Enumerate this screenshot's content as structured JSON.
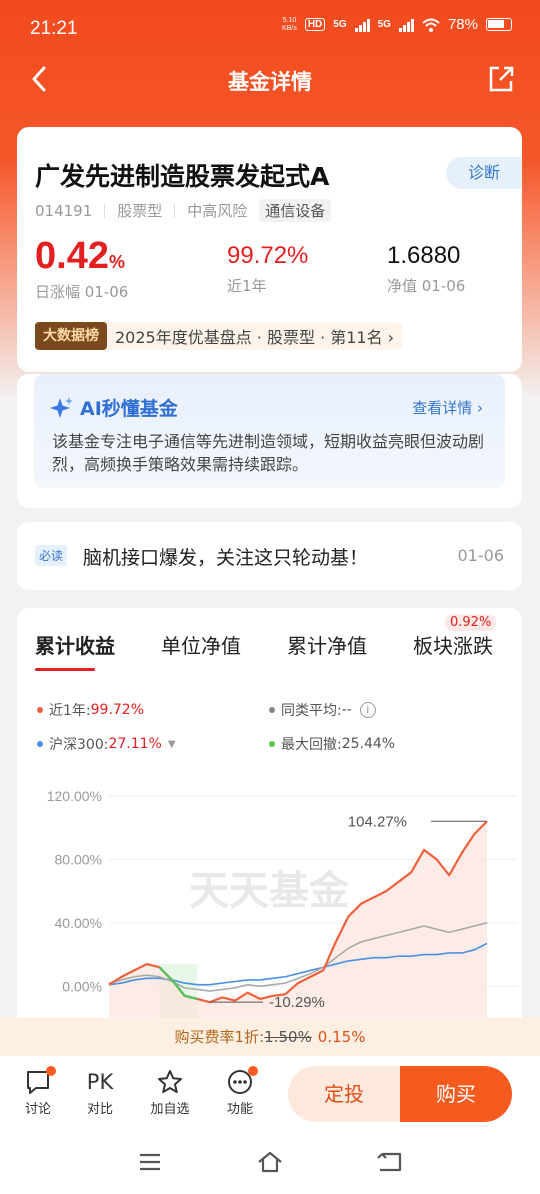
{
  "status": {
    "time": "21:21",
    "net_speed_value": "5.10",
    "net_speed_unit": "KB/s",
    "hd_label": "HD",
    "sig1": "5G",
    "sig2": "5G",
    "battery": "78%"
  },
  "nav": {
    "title": "基金详情"
  },
  "fund": {
    "name": "广发先进制造股票发起式A",
    "code": "014191",
    "type": "股票型",
    "risk": "中高风险",
    "sector": "通信设备",
    "diagnose_label": "诊断",
    "daily_change_value": "0.42",
    "daily_change_unit": "%",
    "daily_change_label": "日涨幅 01-06",
    "year_return": "99.72%",
    "year_return_label": "近1年",
    "nav_value": "1.6880",
    "nav_label": "净值 01-06",
    "rank_badge": "大数据榜",
    "rank_text": "2025年度优基盘点 · 股票型 · 第11名 ›"
  },
  "ai": {
    "title": "AI秒懂基金",
    "more": "查看详情 ›",
    "desc": "该基金专注电子通信等先进制造领域，短期收益亮眼但波动剧烈，高频换手策略效果需持续跟踪。"
  },
  "news": {
    "badge": "必读",
    "text": "脑机接口爆发，关注这只轮动基！",
    "date": "01-06"
  },
  "chart": {
    "tabs": [
      "累计收益",
      "单位净值",
      "累计净值",
      "板块涨跌"
    ],
    "tab_badge": "0.92%",
    "legend": {
      "fund_label": "近1年:",
      "fund_value": "99.72%",
      "peer_label": "同类平均:",
      "peer_value": "--",
      "index_label": "沪深300:",
      "index_value": "27.11%",
      "drawdown_label": "最大回撤:",
      "drawdown_value": "25.44%"
    },
    "watermark": "天天基金",
    "max_label": "104.27%",
    "min_label": "-10.29%",
    "colors": {
      "fund": "#f0603a",
      "index": "#4a90e2",
      "peer": "#aaaaaa",
      "drawdown": "#5cc25c"
    }
  },
  "chart_data": {
    "type": "line",
    "y_ticks": [
      "120.00%",
      "80.00%",
      "40.00%",
      "0.00%"
    ],
    "ylim": [
      -20,
      125
    ],
    "x": [
      0,
      1,
      2,
      3,
      4,
      5,
      6,
      7,
      8,
      9,
      10,
      11,
      12,
      13,
      14,
      15,
      16,
      17,
      18,
      19,
      20,
      21,
      22,
      23,
      24,
      25,
      26,
      27,
      28,
      29,
      30
    ],
    "series": [
      {
        "name": "近1年",
        "values": [
          1,
          6,
          10,
          14,
          12,
          4,
          -6,
          -8,
          -10,
          -7,
          -9,
          -4,
          -8,
          -6,
          -5,
          2,
          6,
          10,
          28,
          44,
          52,
          56,
          60,
          66,
          72,
          86,
          80,
          70,
          84,
          96,
          104
        ]
      },
      {
        "name": "同类平均",
        "values": [
          2,
          4,
          6,
          7,
          6,
          3,
          -1,
          -2,
          -3,
          -2,
          -1,
          1,
          0,
          1,
          2,
          5,
          8,
          12,
          18,
          24,
          28,
          30,
          32,
          34,
          36,
          38,
          36,
          34,
          36,
          38,
          40
        ]
      },
      {
        "name": "沪深300",
        "values": [
          1,
          2,
          4,
          5,
          5,
          4,
          2,
          1,
          1,
          2,
          3,
          4,
          4,
          5,
          6,
          8,
          10,
          12,
          14,
          16,
          17,
          18,
          18,
          19,
          19,
          20,
          20,
          21,
          21,
          23,
          27
        ]
      }
    ]
  },
  "fee": {
    "prefix": "购买费率1折:",
    "old": "1.50%",
    "new": "0.15%"
  },
  "bottom": {
    "discuss": "讨论",
    "compare_icon": "PK",
    "compare": "对比",
    "watch": "加自选",
    "more": "功能",
    "invest": "定投",
    "buy": "购买"
  }
}
